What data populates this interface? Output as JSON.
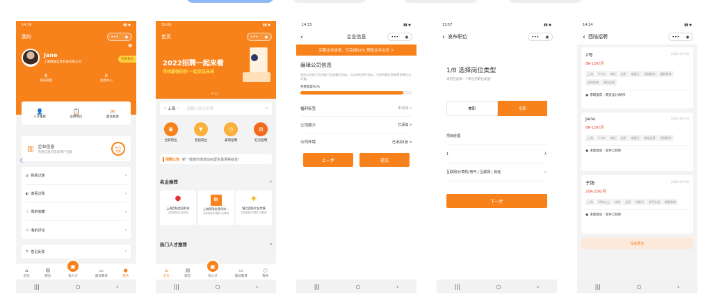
{
  "colors": {
    "accent": "#f7821b",
    "bg": "#f3f3f3"
  },
  "p1": {
    "time": "14:16",
    "title": "我的",
    "name": "Jane",
    "company": "上海西陆信息科技有限公司",
    "switch_btn": "切换身份",
    "stats": [
      {
        "num": "6",
        "label": "发布管理"
      },
      {
        "num": "0",
        "label": "消息中心"
      }
    ],
    "quick": [
      {
        "label": "人才推荐",
        "icon": "👤"
      },
      {
        "label": "应聘简历",
        "icon": "📋"
      },
      {
        "label": "面试邀请",
        "icon": "✉"
      }
    ],
    "company_info_title": "企业信息",
    "company_info_sub": "完善信息可提高用户名额",
    "company_percent": "92%",
    "company_percent_label": "完善",
    "menu": [
      "我看过谁",
      "谁看过我",
      "我的收藏",
      "我的评论",
      "意见反馈"
    ],
    "tabs": [
      "首页",
      "职位",
      "找人才",
      "面试邀请",
      "我的"
    ]
  },
  "p2": {
    "time": "19:09",
    "title": "首页",
    "banner_title": "2022招聘一起来看",
    "banner_sub": "寻找最强的你 一起见证未来",
    "city": "上海",
    "search_placeholder": "请输入职位名称",
    "cats": [
      "全职职位",
      "急招岗位",
      "兼职招聘",
      "红包招聘"
    ],
    "notice_label": "招聘公告",
    "notice_text": "新一线城市度较动召留生最青睐就业!",
    "companies_title": "名企推荐",
    "companies": [
      {
        "name": "上海西陆信息科技",
        "sub": "计算机软件/互联网"
      },
      {
        "name": "上海西陆信息科技...",
        "sub": "计算机软件/硬件/互联网"
      },
      {
        "name": "镇江西陆文化传媒",
        "sub": "计算机软件/硬件/互联网"
      }
    ],
    "hot_title": "热门人才推荐",
    "tabs": [
      "首页",
      "职位",
      "找人才",
      "面试邀请",
      "我的"
    ]
  },
  "p3": {
    "time": "14:33",
    "title": "企业信息",
    "banner": "完善企业信息，已完成92% 预览企业主页 >",
    "heading": "编辑公司信息",
    "desc": "您的公司的主页内容已全部填写完成，可以同时进行优化，为你的职位带来更多曝光与沟通。",
    "progress_label": "完善程度92%",
    "progress": 0.92,
    "rows": [
      {
        "label": "福利标签",
        "value": "未添加 >"
      },
      {
        "label": "公司简介",
        "value": "已添加 >"
      },
      {
        "label": "公司环境",
        "value": "已添加1张 >"
      }
    ],
    "prev": "上一步",
    "submit": "提交"
  },
  "p4": {
    "time": "13:57",
    "title": "发布职位",
    "step_title": "1/8 选择岗位类型",
    "step_sub": "请用任选择一个职位的职位类型!",
    "type_options": [
      "兼职",
      "全职"
    ],
    "fields": [
      {
        "label": "项目经理",
        "value": ""
      },
      {
        "label": "1",
        "value": "人"
      },
      {
        "label": "互联网/计算机/电气 | 互联网 | 其他",
        "value": ">"
      }
    ],
    "next": "下一步"
  },
  "p5": {
    "time": "14:14",
    "title": "西陆招聘",
    "candidates": [
      {
        "name": "2号",
        "date": "2022-03-03",
        "salary": "8K-12K/月",
        "tags": [
          "上海",
          "3-5年",
          "本科",
          "全职",
          "电脑行",
          "视频制作",
          "摄影影像",
          "视频剪辑",
          "微信运营"
        ],
        "intent": "求职意向：网页设计/制作"
      },
      {
        "name": "Jane",
        "date": "2022-02-16",
        "salary": "8K-12K/月",
        "tags": [
          "上海",
          "1-3年",
          "本科",
          "全职",
          "电脑行",
          "微信运营",
          "视频制作"
        ],
        "intent": "求职意向：软件工程师"
      },
      {
        "name": "子扬",
        "date": "2022-02-09",
        "salary": "20K-25K/月",
        "tags": [
          "上海",
          "10年以上",
          "本科",
          "全职",
          "电脑行",
          "新手在线",
          "摄影影像"
        ],
        "intent": "求职意向：软件工程师"
      }
    ],
    "no_more": "没有更多"
  }
}
